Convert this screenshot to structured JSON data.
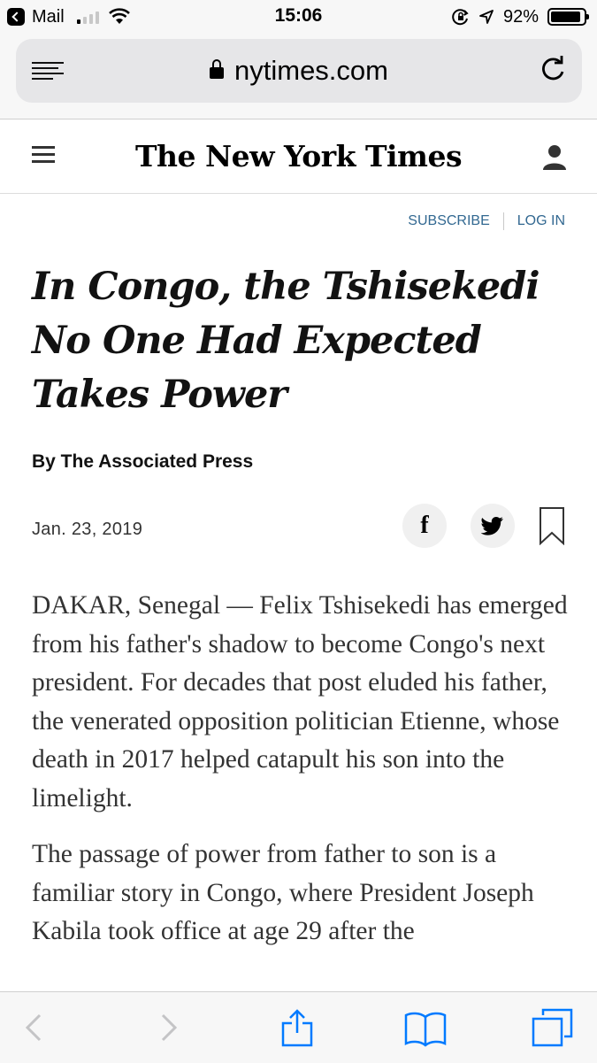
{
  "status_bar": {
    "back_app": "Mail",
    "time": "15:06",
    "battery_percent": "92%",
    "battery_level": 0.92,
    "signal_bars_on": 1,
    "icons": [
      "back-to-app-icon",
      "cellular-signal-icon",
      "wifi-icon",
      "orientation-lock-icon",
      "location-icon",
      "battery-icon"
    ]
  },
  "browser": {
    "url": "nytimes.com",
    "icons": [
      "reader-view-icon",
      "lock-icon",
      "reload-icon"
    ]
  },
  "nyt_header": {
    "masthead": "The New York Times",
    "icons": [
      "menu-icon",
      "account-icon"
    ]
  },
  "top_links": {
    "subscribe": "SUBSCRIBE",
    "login": "LOG IN"
  },
  "article": {
    "headline": "In Congo, the Tshisekedi No One Had Expected Takes Power",
    "byline": "By The Associated Press",
    "date": "Jan. 23, 2019",
    "share_facebook": "f",
    "paragraphs": [
      "DAKAR, Senegal — Felix Tshisekedi has emerged from his father's shadow to become Congo's next president. For decades that post eluded his father, the venerated opposition politician Etienne, whose death in 2017 helped catapult his son into the limelight.",
      "The passage of power from father to son is a familiar story in Congo, where President Joseph Kabila took office at age 29 after the"
    ]
  },
  "toolbar": {
    "icons": [
      "back-icon",
      "forward-icon",
      "share-icon",
      "bookmarks-icon",
      "tabs-icon"
    ]
  },
  "colors": {
    "link_blue": "#326891",
    "ios_blue": "#007aff",
    "text": "#121212",
    "body_text": "#333333",
    "chrome_bg": "#f7f7f7"
  }
}
